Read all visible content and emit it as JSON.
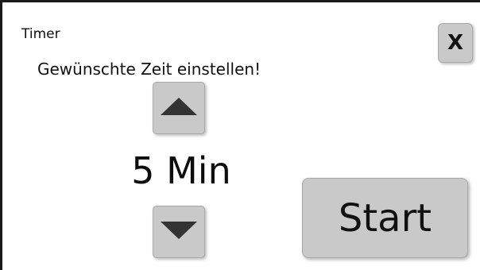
{
  "window": {
    "title": "Timer",
    "close_label": "X"
  },
  "timer": {
    "instruction": "Gewünschte Zeit einstellen!",
    "value_display": "5 Min",
    "increase_icon": "triangle-up-icon",
    "decrease_icon": "triangle-down-icon",
    "start_label": "Start"
  },
  "colors": {
    "button_bg": "#c9c9c9",
    "icon": "#333333",
    "text": "#111111",
    "frame": "#1a1a1a"
  }
}
